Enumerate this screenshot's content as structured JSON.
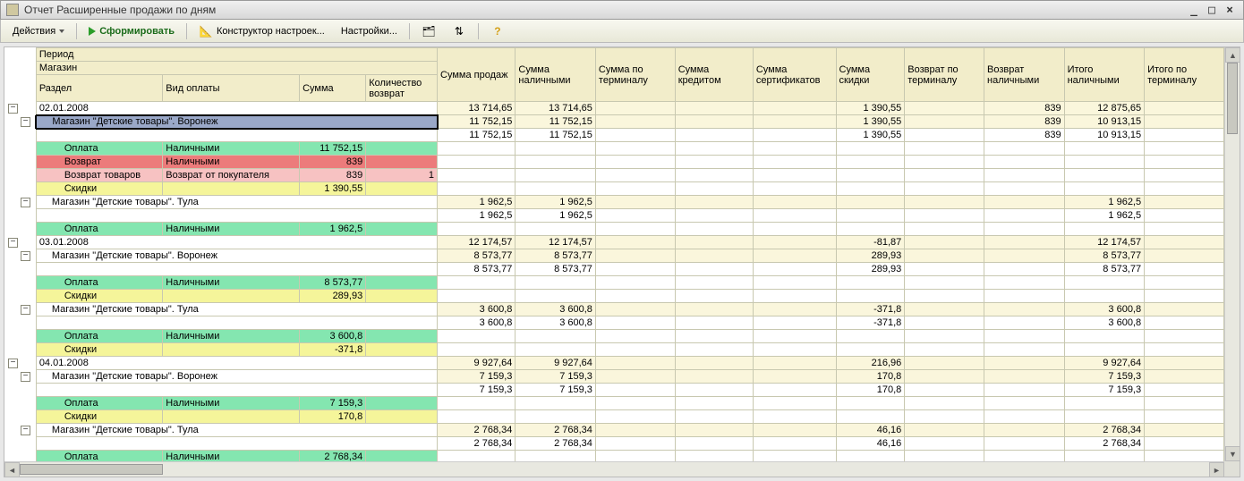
{
  "window": {
    "title": "Отчет  Расширенные продажи по дням"
  },
  "toolbar": {
    "actions": "Действия",
    "run": "Сформировать",
    "builder": "Конструктор настроек...",
    "settings": "Настройки..."
  },
  "headers": {
    "period": "Период",
    "store": "Магазин",
    "section": "Раздел",
    "paytype": "Вид оплаты",
    "sum": "Сумма",
    "qty_return": "Количество возврат",
    "c1": "Сумма продаж",
    "c2": "Сумма наличными",
    "c3": "Сумма по терминалу",
    "c4": "Сумма кредитом",
    "c5": "Сумма сертификатов",
    "c6": "Сумма скидки",
    "c7": "Возврат по терминалу",
    "c8": "Возврат наличными",
    "c9": "Итого наличными",
    "c10": "Итого по терминалу"
  },
  "labels": {
    "pay": "Оплата",
    "cash": "Наличными",
    "return": "Возврат",
    "return_goods": "Возврат товаров",
    "return_buyer": "Возврат от покупателя",
    "discounts": "Скидки",
    "store_vrn": "Магазин \"Детские товары\". Воронеж",
    "store_tula": "Магазин \"Детские товары\". Тула"
  },
  "rows": [
    {
      "t": "date",
      "level": 0,
      "cells": [
        "02.01.2008",
        "",
        "",
        "",
        "13 714,65",
        "13 714,65",
        "",
        "",
        "",
        "1 390,55",
        "",
        "839",
        "12 875,65",
        ""
      ]
    },
    {
      "t": "store",
      "level": 1,
      "selected": true,
      "cells": [
        "@store_vrn",
        "",
        "",
        "",
        "11 752,15",
        "11 752,15",
        "",
        "",
        "",
        "1 390,55",
        "",
        "839",
        "10 913,15",
        ""
      ]
    },
    {
      "t": "blank",
      "level": 2,
      "cells": [
        "",
        "",
        "",
        "",
        "11 752,15",
        "11 752,15",
        "",
        "",
        "",
        "1 390,55",
        "",
        "839",
        "10 913,15",
        ""
      ]
    },
    {
      "t": "pay",
      "level": 2,
      "color": "green",
      "cells": [
        "@pay",
        "@cash",
        "11 752,15",
        "",
        "",
        "",
        "",
        "",
        "",
        "",
        "",
        "",
        "",
        ""
      ]
    },
    {
      "t": "ret",
      "level": 2,
      "color": "red",
      "cells": [
        "@return",
        "@cash",
        "839",
        "",
        "",
        "",
        "",
        "",
        "",
        "",
        "",
        "",
        "",
        ""
      ]
    },
    {
      "t": "retg",
      "level": 2,
      "color": "pink",
      "cells": [
        "@return_goods",
        "@return_buyer",
        "839",
        "1",
        "",
        "",
        "",
        "",
        "",
        "",
        "",
        "",
        "",
        ""
      ]
    },
    {
      "t": "disc",
      "level": 2,
      "color": "yellow",
      "cells": [
        "@discounts",
        "",
        "1 390,55",
        "",
        "",
        "",
        "",
        "",
        "",
        "",
        "",
        "",
        "",
        ""
      ]
    },
    {
      "t": "store",
      "level": 1,
      "cells": [
        "@store_tula",
        "",
        "",
        "",
        "1 962,5",
        "1 962,5",
        "",
        "",
        "",
        "",
        "",
        "",
        "1 962,5",
        ""
      ]
    },
    {
      "t": "blank",
      "level": 2,
      "cells": [
        "",
        "",
        "",
        "",
        "1 962,5",
        "1 962,5",
        "",
        "",
        "",
        "",
        "",
        "",
        "1 962,5",
        ""
      ]
    },
    {
      "t": "pay",
      "level": 2,
      "color": "green",
      "cells": [
        "@pay",
        "@cash",
        "1 962,5",
        "",
        "",
        "",
        "",
        "",
        "",
        "",
        "",
        "",
        "",
        ""
      ]
    },
    {
      "t": "date",
      "level": 0,
      "cells": [
        "03.01.2008",
        "",
        "",
        "",
        "12 174,57",
        "12 174,57",
        "",
        "",
        "",
        "-81,87",
        "",
        "",
        "12 174,57",
        ""
      ]
    },
    {
      "t": "store",
      "level": 1,
      "cells": [
        "@store_vrn",
        "",
        "",
        "",
        "8 573,77",
        "8 573,77",
        "",
        "",
        "",
        "289,93",
        "",
        "",
        "8 573,77",
        ""
      ]
    },
    {
      "t": "blank",
      "level": 2,
      "cells": [
        "",
        "",
        "",
        "",
        "8 573,77",
        "8 573,77",
        "",
        "",
        "",
        "289,93",
        "",
        "",
        "8 573,77",
        ""
      ]
    },
    {
      "t": "pay",
      "level": 2,
      "color": "green",
      "cells": [
        "@pay",
        "@cash",
        "8 573,77",
        "",
        "",
        "",
        "",
        "",
        "",
        "",
        "",
        "",
        "",
        ""
      ]
    },
    {
      "t": "disc",
      "level": 2,
      "color": "yellow",
      "cells": [
        "@discounts",
        "",
        "289,93",
        "",
        "",
        "",
        "",
        "",
        "",
        "",
        "",
        "",
        "",
        ""
      ]
    },
    {
      "t": "store",
      "level": 1,
      "cells": [
        "@store_tula",
        "",
        "",
        "",
        "3 600,8",
        "3 600,8",
        "",
        "",
        "",
        "-371,8",
        "",
        "",
        "3 600,8",
        ""
      ]
    },
    {
      "t": "blank",
      "level": 2,
      "cells": [
        "",
        "",
        "",
        "",
        "3 600,8",
        "3 600,8",
        "",
        "",
        "",
        "-371,8",
        "",
        "",
        "3 600,8",
        ""
      ]
    },
    {
      "t": "pay",
      "level": 2,
      "color": "green",
      "cells": [
        "@pay",
        "@cash",
        "3 600,8",
        "",
        "",
        "",
        "",
        "",
        "",
        "",
        "",
        "",
        "",
        ""
      ]
    },
    {
      "t": "disc",
      "level": 2,
      "color": "yellow",
      "cells": [
        "@discounts",
        "",
        "-371,8",
        "",
        "",
        "",
        "",
        "",
        "",
        "",
        "",
        "",
        "",
        ""
      ]
    },
    {
      "t": "date",
      "level": 0,
      "cells": [
        "04.01.2008",
        "",
        "",
        "",
        "9 927,64",
        "9 927,64",
        "",
        "",
        "",
        "216,96",
        "",
        "",
        "9 927,64",
        ""
      ]
    },
    {
      "t": "store",
      "level": 1,
      "cells": [
        "@store_vrn",
        "",
        "",
        "",
        "7 159,3",
        "7 159,3",
        "",
        "",
        "",
        "170,8",
        "",
        "",
        "7 159,3",
        ""
      ]
    },
    {
      "t": "blank",
      "level": 2,
      "cells": [
        "",
        "",
        "",
        "",
        "7 159,3",
        "7 159,3",
        "",
        "",
        "",
        "170,8",
        "",
        "",
        "7 159,3",
        ""
      ]
    },
    {
      "t": "pay",
      "level": 2,
      "color": "green",
      "cells": [
        "@pay",
        "@cash",
        "7 159,3",
        "",
        "",
        "",
        "",
        "",
        "",
        "",
        "",
        "",
        "",
        ""
      ]
    },
    {
      "t": "disc",
      "level": 2,
      "color": "yellow",
      "cells": [
        "@discounts",
        "",
        "170,8",
        "",
        "",
        "",
        "",
        "",
        "",
        "",
        "",
        "",
        "",
        ""
      ]
    },
    {
      "t": "store",
      "level": 1,
      "cells": [
        "@store_tula",
        "",
        "",
        "",
        "2 768,34",
        "2 768,34",
        "",
        "",
        "",
        "46,16",
        "",
        "",
        "2 768,34",
        ""
      ]
    },
    {
      "t": "blank",
      "level": 2,
      "cells": [
        "",
        "",
        "",
        "",
        "2 768,34",
        "2 768,34",
        "",
        "",
        "",
        "46,16",
        "",
        "",
        "2 768,34",
        ""
      ]
    },
    {
      "t": "pay",
      "level": 2,
      "color": "green",
      "cells": [
        "@pay",
        "@cash",
        "2 768,34",
        "",
        "",
        "",
        "",
        "",
        "",
        "",
        "",
        "",
        "",
        ""
      ]
    }
  ]
}
